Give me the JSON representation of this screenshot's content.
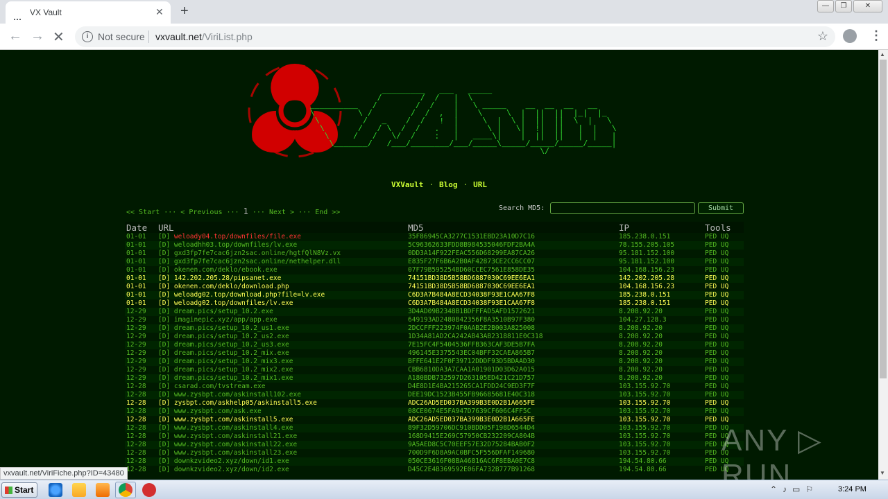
{
  "browser": {
    "tab_title": "VX Vault",
    "not_secure": "Not secure",
    "url_host": "vxvault.net",
    "url_path": "/ViriList.php",
    "status_url": "vxvault.net/ViriFiche.php?ID=43480"
  },
  "site": {
    "nav": [
      "VXVault",
      "Blog",
      "URL"
    ],
    "pager": {
      "start": "<< Start",
      "previous": "< Previous",
      "current": "1",
      "next": "Next >",
      "end": "End >>"
    },
    "search_label": "Search MD5:",
    "search_value": "",
    "submit": "Submit",
    "columns": [
      "Date",
      "URL",
      "MD5",
      "IP",
      "Tools"
    ],
    "rows": [
      {
        "date": "01-01",
        "url": "weloady04.top/downfiles/file.exe",
        "md5": "35F86945CA3277C1531EBD23A10D7C16",
        "ip": "185.238.0.151",
        "style": "red"
      },
      {
        "date": "01-01",
        "url": "weloadhh03.top/downfiles/lv.exe",
        "md5": "5C96362633FDD8B984535046FDF2BA4A",
        "ip": "78.155.205.105",
        "style": ""
      },
      {
        "date": "01-01",
        "url": "gxd3fp7fe7cac6jzn2sac.online/hgtfQlN8Vz.vx",
        "md5": "0DD3A14F922FEAC556D68299EA87CA26",
        "ip": "95.181.152.100",
        "style": ""
      },
      {
        "date": "01-01",
        "url": "gxd3fp7fe7cac6jzn2sac.online/nethelper.dll",
        "md5": "E835F27F6B6A2B0AF42873CE2CC6CC07",
        "ip": "95.181.152.100",
        "style": ""
      },
      {
        "date": "01-01",
        "url": "okenen.com/deklo/ebook.exe",
        "md5": "07F79B595254BD60CCEC7561E858DE35",
        "ip": "104.168.156.23",
        "style": ""
      },
      {
        "date": "01-01",
        "url": "142.202.205.28/pipsanet.exe",
        "md5": "74151BD38D5B58BD6887030C69EE6EA1",
        "ip": "142.202.205.28",
        "style": "hi"
      },
      {
        "date": "01-01",
        "url": "okenen.com/deklo/download.php",
        "md5": "74151BD38D5B58BD6887030C69EE6EA1",
        "ip": "104.168.156.23",
        "style": "hi"
      },
      {
        "date": "01-01",
        "url": "weloadg02.top/download.php?file=lv.exe",
        "md5": "C6D3A7B484A8ECD34038F93E1CAA67F8",
        "ip": "185.238.0.151",
        "style": "hi"
      },
      {
        "date": "01-01",
        "url": "weloadg02.top/downfiles/lv.exe",
        "md5": "C6D3A7B484A8ECD34038F93E1CAA67F8",
        "ip": "185.238.0.151",
        "style": "hi"
      },
      {
        "date": "12-29",
        "url": "dream.pics/setup_10.2.exe",
        "md5": "3D4AD09B2348B1BDFFFAD5AFD1572621",
        "ip": "8.208.92.20",
        "style": ""
      },
      {
        "date": "12-29",
        "url": "imaginepic.xyz/app/app.exe",
        "md5": "649193AD2480B42356F8A3510B97F380",
        "ip": "104.27.128.3",
        "style": ""
      },
      {
        "date": "12-29",
        "url": "dream.pics/setup_10.2_us1.exe",
        "md5": "2DCCFFF223974F0AAB2E2B003A825008",
        "ip": "8.208.92.20",
        "style": ""
      },
      {
        "date": "12-29",
        "url": "dream.pics/setup_10.2_us2.exe",
        "md5": "1D34A81AD2CA242AB43AB2318811E0C318",
        "ip": "8.208.92.20",
        "style": ""
      },
      {
        "date": "12-29",
        "url": "dream.pics/setup_10.2_us3.exe",
        "md5": "7E15FC4F5404536FFB363CAF3DE5B7FA",
        "ip": "8.208.92.20",
        "style": ""
      },
      {
        "date": "12-29",
        "url": "dream.pics/setup_10.2_mix.exe",
        "md5": "496145E3375543EC04BFF32CAEA865B7",
        "ip": "8.208.92.20",
        "style": ""
      },
      {
        "date": "12-29",
        "url": "dream.pics/setup_10.2_mix3.exe",
        "md5": "BFFE641E2F0F39712DDDF93D5BDAAD30",
        "ip": "8.208.92.20",
        "style": ""
      },
      {
        "date": "12-29",
        "url": "dream.pics/setup_10.2_mix2.exe",
        "md5": "CBB6810DA3A7CAA1A01901D03D62A015",
        "ip": "8.208.92.20",
        "style": ""
      },
      {
        "date": "12-29",
        "url": "dream.pics/setup_10.2_mix1.exe",
        "md5": "A180BDB732597D263105ED421C21D757",
        "ip": "8.208.92.20",
        "style": ""
      },
      {
        "date": "12-28",
        "url": "csarad.com/tvstream.exe",
        "md5": "D4E8D1E4BA215265CA1FDD24C9ED3F7F",
        "ip": "103.155.92.70",
        "style": ""
      },
      {
        "date": "12-28",
        "url": "www.zysbpt.com/askinstall102.exe",
        "md5": "DEE19DC1523B455FB96685681E40C318",
        "ip": "103.155.92.70",
        "style": ""
      },
      {
        "date": "12-28",
        "url": "zysbpt.com/askhelp05/askinstall5.exe",
        "md5": "ADC26AD5ED037BA399B3E0D2B1A665FE",
        "ip": "103.155.92.70",
        "style": "hi"
      },
      {
        "date": "12-28",
        "url": "www.zysbpt.com/ask.exe",
        "md5": "08CE0674E5FA947D7639CF606C4FF5C",
        "ip": "103.155.92.70",
        "style": ""
      },
      {
        "date": "12-28",
        "url": "www.zysbpt.com/askinstall5.exe",
        "md5": "ADC26AD5ED037BA399B3E0D2B1A665FE",
        "ip": "103.155.92.70",
        "style": "hi"
      },
      {
        "date": "12-28",
        "url": "www.zysbpt.com/askinstall4.exe",
        "md5": "89F32D59706DC910BDD05F198D6544D4",
        "ip": "103.155.92.70",
        "style": ""
      },
      {
        "date": "12-28",
        "url": "www.zysbpt.com/askinstall21.exe",
        "md5": "168D9415E269C57950CB232209CA804B",
        "ip": "103.155.92.70",
        "style": ""
      },
      {
        "date": "12-28",
        "url": "www.zysbpt.com/askinstall22.exe",
        "md5": "9A5AED8C5C70EEF57E32D75284BAB0F2",
        "ip": "103.155.92.70",
        "style": ""
      },
      {
        "date": "12-28",
        "url": "www.zysbpt.com/askinstall23.exe",
        "md5": "700D9F6D8A9AC0BFC5F556DFAF149680",
        "ip": "103.155.92.70",
        "style": ""
      },
      {
        "date": "12-28",
        "url": "downkzvideo2.xyz/down/id1.exe",
        "md5": "050CE3616F08BA46816AC6F8EBA0E7C8",
        "ip": "194.54.80.66",
        "style": ""
      },
      {
        "date": "12-28",
        "url": "downkzvideo2.xyz/down/id2.exe",
        "md5": "D45C2E4B369592E06FA732B777B91268",
        "ip": "194.54.80.66",
        "style": ""
      }
    ],
    "tools": [
      "PED",
      "UQ"
    ],
    "url_prefix": "[D]"
  },
  "watermark": "ANY ▷ RUN",
  "taskbar": {
    "start": "Start",
    "time": "3:24 PM"
  }
}
